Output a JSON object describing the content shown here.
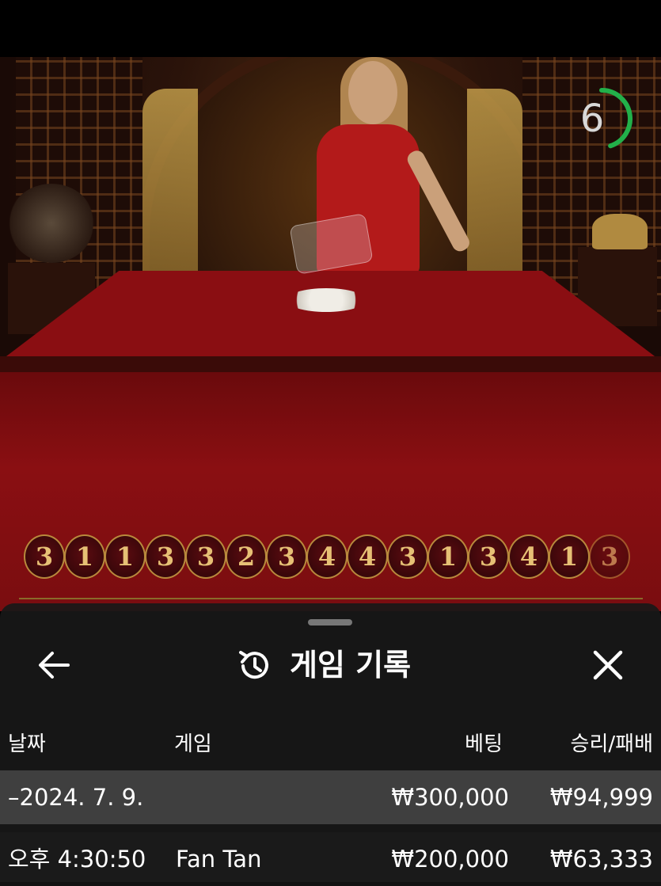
{
  "timer": {
    "seconds": "6",
    "ring_color": "#22b04a",
    "progress": 0.45
  },
  "bead_road": [
    "3",
    "1",
    "1",
    "3",
    "3",
    "2",
    "3",
    "4",
    "4",
    "3",
    "1",
    "3",
    "4",
    "1",
    "3"
  ],
  "history_sheet": {
    "title": "게임 기록",
    "icons": {
      "back": "arrow-left-icon",
      "history": "history-icon",
      "close": "close-icon"
    },
    "columns": {
      "date": "날짜",
      "game": "게임",
      "bet": "베팅",
      "win_loss": "승리/패배"
    },
    "rows": [
      {
        "date": "–2024. 7. 9.",
        "game": "",
        "bet": "₩300,000",
        "win_loss": "₩94,999"
      },
      {
        "date": "오후 4:30:50",
        "game": "Fan Tan",
        "bet": "₩200,000",
        "win_loss": "₩63,333"
      }
    ]
  }
}
